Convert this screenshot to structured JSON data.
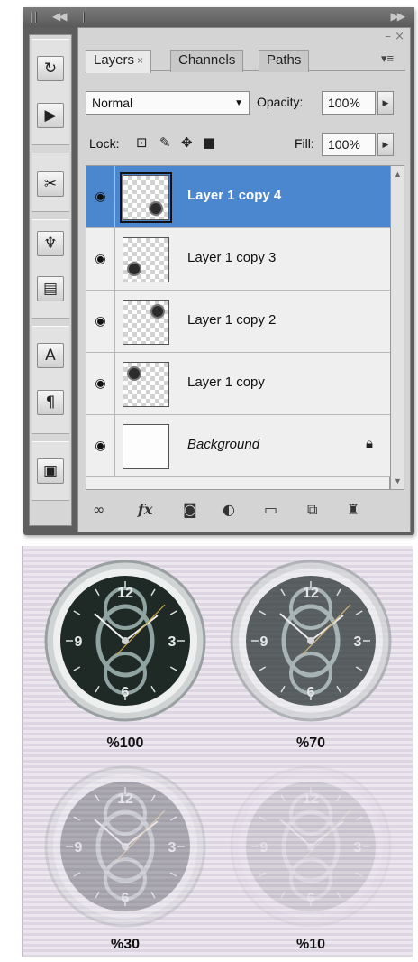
{
  "panel": {
    "close_glyph": "– ×",
    "tabs": [
      {
        "label": "Layers",
        "close": "×"
      },
      {
        "label": "Channels"
      },
      {
        "label": "Paths"
      }
    ],
    "menu_glyph": "▾≡",
    "blend_mode": "Normal",
    "opacity_label": "Opacity:",
    "opacity_value": "100%",
    "lock_label": "Lock:",
    "fill_label": "Fill:",
    "fill_value": "100%"
  },
  "layers": [
    {
      "name": "Layer 1 copy 4",
      "selected": true
    },
    {
      "name": "Layer 1 copy 3",
      "selected": false
    },
    {
      "name": "Layer 1 copy 2",
      "selected": false
    },
    {
      "name": "Layer 1 copy",
      "selected": false
    },
    {
      "name": "Background",
      "selected": false,
      "locked": true
    }
  ],
  "footer_icons": [
    "link-icon",
    "fx-icon",
    "mask-icon",
    "adjustment-icon",
    "folder-icon",
    "new-layer-icon",
    "trash-icon"
  ],
  "footer_fx": "fx",
  "clocks": [
    {
      "caption": "%100",
      "opacity": 1.0
    },
    {
      "caption": "%70",
      "opacity": 0.7
    },
    {
      "caption": "%30",
      "opacity": 0.3
    },
    {
      "caption": "%10",
      "opacity": 0.1
    }
  ],
  "clock_numerals": [
    "12",
    "3",
    "6",
    "9"
  ],
  "colors": {
    "selection": "#4b87cf",
    "clock_face": "#1f2a27"
  }
}
